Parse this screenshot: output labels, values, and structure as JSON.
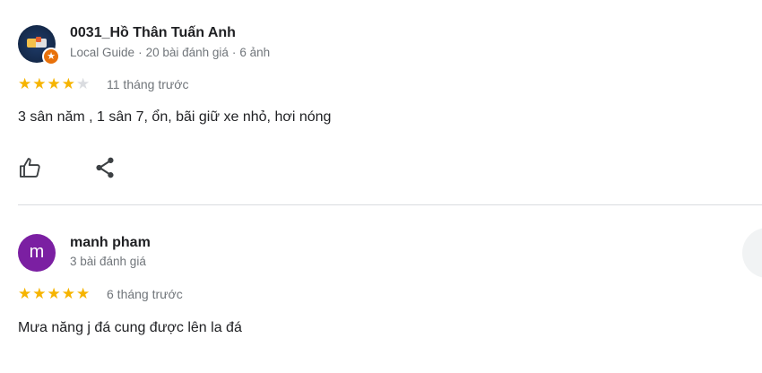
{
  "reviews": [
    {
      "author": "0031_Hồ Thân Tuấn Anh",
      "local_guide": "Local Guide",
      "review_count": "20 bài đánh giá",
      "photo_count": "6 ảnh",
      "rating": 4,
      "rating_max": 5,
      "time": "11 tháng trước",
      "text": "3 sân năm , 1 sân 7, ổn, bãi giữ xe nhỏ, hơi nóng",
      "icons": {
        "like": "thumbs-up-icon",
        "share": "share-icon",
        "badge": "local-guide-star-icon"
      }
    },
    {
      "author": "manh pham",
      "avatar_letter": "m",
      "review_count": "3 bài đánh giá",
      "rating": 5,
      "rating_max": 5,
      "time": "6 tháng trước",
      "text": "Mưa năng j đá cung được lên la đá"
    }
  ],
  "colors": {
    "star_filled": "#f6b400",
    "star_empty": "#dadce0",
    "avatar_m": "#7b1fa2",
    "local_guide_badge": "#e8710a",
    "secondary_text": "#70757a"
  }
}
